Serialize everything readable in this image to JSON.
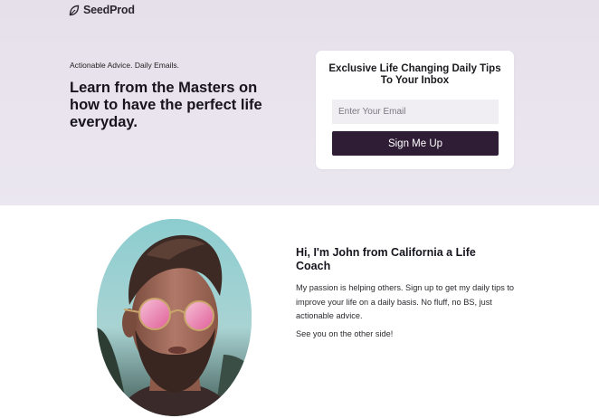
{
  "brand": {
    "name": "SeedProd",
    "icon": "leaf-icon"
  },
  "hero": {
    "tagline": "Actionable Advice. Daily Emails.",
    "headline": "Learn from the Masters on how to have the perfect life everyday."
  },
  "signup_card": {
    "title": "Exclusive Life Changing Daily Tips To Your Inbox",
    "email_placeholder": "Enter Your Email",
    "email_value": "",
    "button_label": "Sign Me Up"
  },
  "about": {
    "title": "Hi, I'm John from California a Life Coach",
    "body": "My passion is helping others. Sign up to get my daily tips to improve your life on a daily basis. No fluff, no BS, just actionable advice.",
    "closing": "See you on the other side!"
  },
  "colors": {
    "hero_bg": "#e8e3ed",
    "button_bg": "#2f1d36",
    "input_bg": "#f0eef3"
  }
}
